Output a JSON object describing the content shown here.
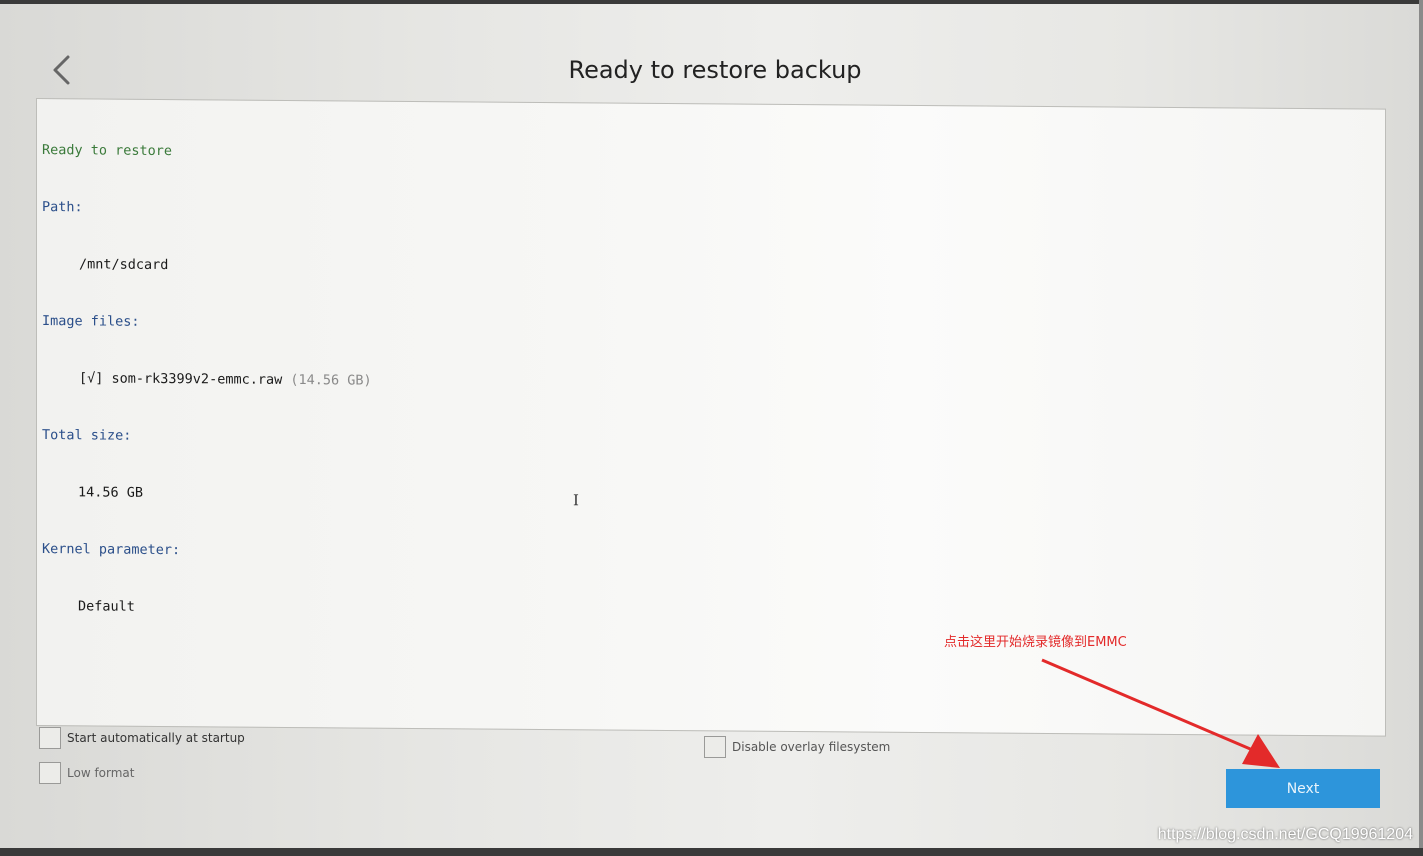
{
  "header": {
    "title": "Ready to restore backup",
    "back_icon": "chevron-left-icon"
  },
  "log": {
    "ready": "Ready to restore",
    "path_label": "Path:",
    "path_value": "/mnt/sdcard",
    "image_files_label": "Image files:",
    "image_file_check": "[√]",
    "image_file_name": "som-rk3399v2-emmc.raw",
    "image_file_size": "(14.56 GB)",
    "total_size_label": "Total size:",
    "total_size_value": "14.56 GB",
    "kernel_param_label": "Kernel parameter:",
    "kernel_param_value": "Default",
    "cursor": "I"
  },
  "options": {
    "start_auto": {
      "label": "Start automatically at startup",
      "checked": false
    },
    "low_format": {
      "label": "Low format",
      "checked": false
    },
    "disable_overlay": {
      "label": "Disable overlay filesystem",
      "checked": false
    }
  },
  "footer": {
    "next_label": "Next"
  },
  "annotation": {
    "text": "点击这里开始烧录镜像到EMMC",
    "color": "#e32a2a"
  },
  "watermark": "https://blog.csdn.net/GCQ19961204",
  "colors": {
    "accent": "#2d95db",
    "log_green": "#3a7a3a",
    "log_blue": "#2b4f8a"
  }
}
